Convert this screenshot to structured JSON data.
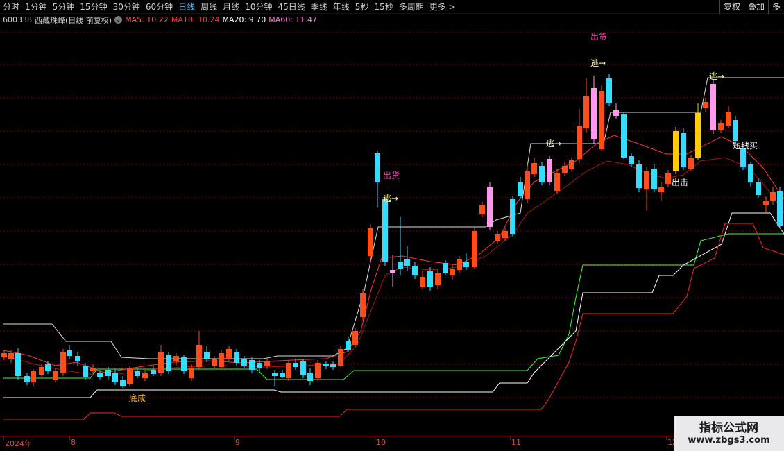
{
  "toolbar": {
    "periods": [
      "分时",
      "1分钟",
      "5分钟",
      "15分钟",
      "30分钟",
      "60分钟",
      "日线",
      "周线",
      "月线",
      "10分钟",
      "45日线",
      "季线",
      "年线",
      "5秒",
      "15秒",
      "多周期",
      "更多 >"
    ],
    "active": "日线",
    "right_buttons": [
      "复权",
      "叠加",
      "多"
    ]
  },
  "info": {
    "code": "600338",
    "name": "西藏珠峰(日线 前复权)",
    "ma5": "MA5: 10.22",
    "ma10": "MA10: 10.24",
    "ma20": "MA20: 9.70",
    "ma60": "MA60: 11.47"
  },
  "colors": {
    "up": "#ff4d1a",
    "down": "#33ddff",
    "pink": "#ff99ee",
    "gold": "#ffcc00",
    "ma5": "#ffffff",
    "ma10": "#ff3333",
    "ma20": "#ffffff",
    "ma60": "#ff66cc"
  },
  "annotations": [
    {
      "text": "出货",
      "color": "#ff33aa"
    },
    {
      "text": "逃→",
      "color": "#ffffaa"
    },
    {
      "text": "出货",
      "color": "#ff33aa"
    },
    {
      "text": "逃→",
      "color": "#ffffaa"
    },
    {
      "text": "逃→",
      "color": "#ffffaa"
    },
    {
      "text": "逃→",
      "color": "#ffffaa"
    },
    {
      "text": "短线买",
      "color": "#ffffff"
    },
    {
      "text": "出击",
      "color": "#ffffff"
    },
    {
      "text": "底成",
      "color": "#ffaa33"
    }
  ],
  "date_axis": [
    "2024年",
    "8",
    "9",
    "10",
    "11",
    "12"
  ],
  "watermark": {
    "title": "指标公式网",
    "url": "www.zbgs3.com"
  }
}
